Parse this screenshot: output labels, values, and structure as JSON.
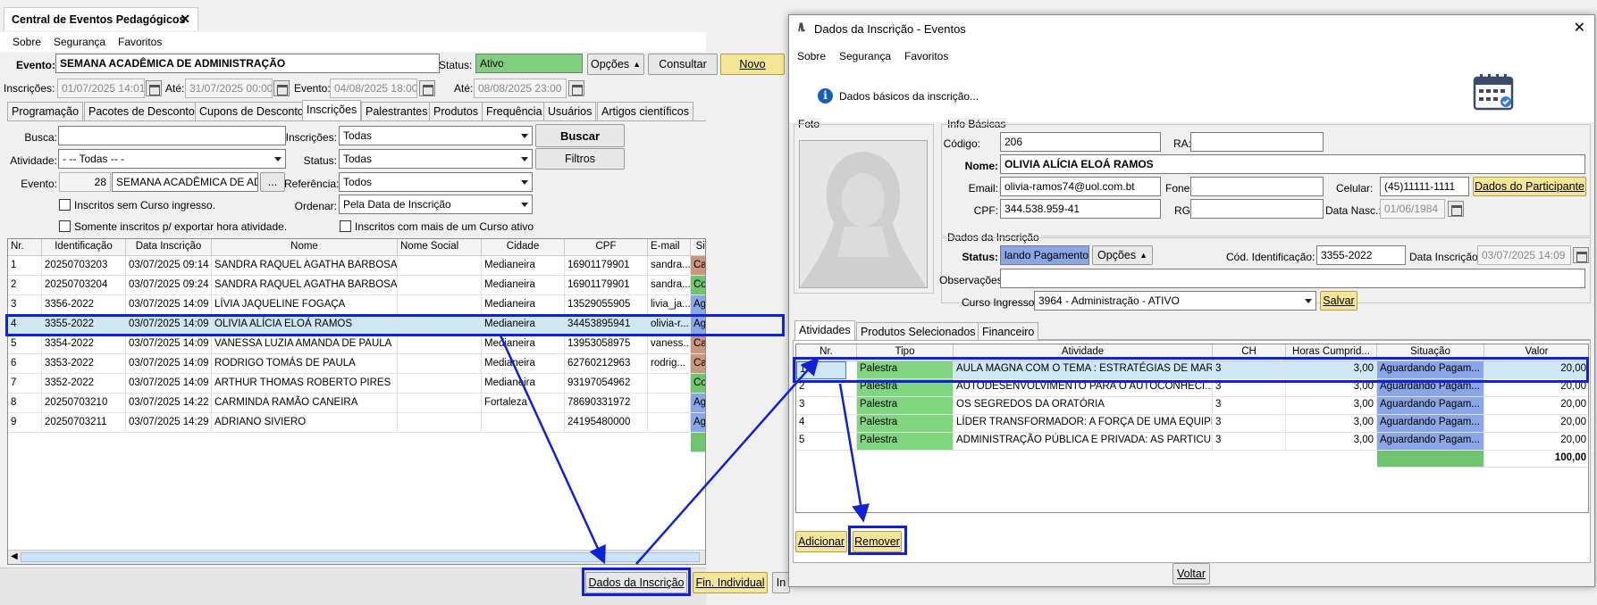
{
  "main": {
    "tab_title": "Central de Eventos Pedagógicos",
    "menu": [
      "Sobre",
      "Segurança",
      "Favoritos"
    ],
    "evento_label": "Evento:",
    "evento_value": "SEMANA ACADÊMICA DE ADMINISTRAÇÃO",
    "status_label": "Status:",
    "status_value": "Ativo",
    "opcoes_btn": "Opções",
    "consultar_btn": "Consultar",
    "novo_btn": "Novo",
    "inscricoes_label": "Inscrições:",
    "inscricoes_from": "01/07/2025 14:01",
    "ate_label": "Até:",
    "inscricoes_to": "31/07/2025 00:00",
    "evento_date_label": "Evento:",
    "evento_from": "04/08/2025 18:00",
    "evento_ate_label": "Até:",
    "evento_to": "08/08/2025 23:00",
    "tabs": [
      "Programação",
      "Pacotes de Desconto",
      "Cupons de Desconto",
      "Inscrições",
      "Palestrantes",
      "Produtos",
      "Frequência",
      "Usuários",
      "Artigos científicos"
    ],
    "filters": {
      "busca_label": "Busca:",
      "busca_value": "",
      "inscricoes_label": "Inscrições:",
      "inscricoes_value": "Todas",
      "buscar_btn": "Buscar",
      "atividade_label": "Atividade:",
      "atividade_value": "- -- Todas -- -",
      "status_label": "Status:",
      "status_value": "Todas",
      "filtros_btn": "Filtros",
      "evento_label": "Evento:",
      "evento_num": "28",
      "evento_name": "SEMANA ACADÊMICA DE ADM",
      "evento_more": "...",
      "referencia_label": "Referência:",
      "referencia_value": "Todos",
      "ordenar_label": "Ordenar:",
      "ordenar_value": "Pela Data de Inscrição",
      "chk1": "Inscritos sem Curso ingresso.",
      "chk2": "Somente inscritos p/ exportar hora atividade.",
      "chk3": "Inscritos com mais de um Curso ativo"
    },
    "columns": [
      "Nr.",
      "Identificação",
      "Data Inscrição",
      "Nome",
      "Nome Social",
      "Cidade",
      "CPF",
      "E-mail",
      "Situação no Evento"
    ],
    "rows": [
      [
        "1",
        "20250703203",
        "03/07/2025 09:14",
        "SANDRA RAQUEL AGATHA BARBOSA",
        "",
        "Medianeira",
        "16901179901",
        "sandra...",
        "Cancelada"
      ],
      [
        "2",
        "20250703204",
        "03/07/2025 09:24",
        "SANDRA RAQUEL AGATHA BARBOSA",
        "",
        "Medianeira",
        "16901179901",
        "sandra...",
        "Confirmada"
      ],
      [
        "3",
        "3356-2022",
        "03/07/2025 14:09",
        "LÍVIA JAQUELINE FOGAÇA",
        "",
        "Medianeira",
        "13529055905",
        "livia_ja...",
        "Aguardando Paga..."
      ],
      [
        "4",
        "3355-2022",
        "03/07/2025 14:09",
        "OLIVIA ALÍCIA ELOÁ RAMOS",
        "",
        "Medianeira",
        "34453895941",
        "olivia-r...",
        "Aguardando Paga..."
      ],
      [
        "5",
        "3354-2022",
        "03/07/2025 14:09",
        "VANESSA LUZIA AMANDA DE PAULA",
        "",
        "Medianeira",
        "13953058975",
        "vaness...",
        "Cancelada"
      ],
      [
        "6",
        "3353-2022",
        "03/07/2025 14:09",
        "RODRIGO TOMÁS DE PAULA",
        "",
        "Medianeira",
        "62760212963",
        "rodrig...",
        "Cancelada"
      ],
      [
        "7",
        "3352-2022",
        "03/07/2025 14:09",
        "ARTHUR THOMAS ROBERTO PIRES",
        "",
        "Medianeira",
        "93197054962",
        "",
        "Confirmada"
      ],
      [
        "8",
        "20250703210",
        "03/07/2025 14:22",
        "CARMINDA RAMÃO CANEIRA",
        "",
        "Fortaleza",
        "78690331972",
        "",
        "Aguardando Paga..."
      ],
      [
        "9",
        "20250703211",
        "03/07/2025 14:29",
        "ADRIANO SIVIERO",
        "",
        "",
        "24195480000",
        "",
        "Aguardando Paga..."
      ]
    ],
    "bottom": {
      "dados_btn": "Dados da Inscrição",
      "fin_btn": "Fin. Individual",
      "extra_btn": "In"
    }
  },
  "dialog": {
    "title": "Dados da Inscrição - Eventos",
    "menu": [
      "Sobre",
      "Segurança",
      "Favoritos"
    ],
    "header_text": "Dados básicos da inscrição...",
    "foto_label": "Foto",
    "info_label": "Info Básicas",
    "codigo_label": "Código:",
    "codigo_value": "206",
    "ra_label": "RA:",
    "ra_value": "",
    "nome_label": "Nome:",
    "nome_value": "OLIVIA ALÍCIA ELOÁ RAMOS",
    "email_label": "Email:",
    "email_value": "olivia-ramos74@uol.com.bt",
    "fone_label": "Fone:",
    "fone_value": "",
    "celular_label": "Celular:",
    "celular_value": "(45)11111-1111",
    "dados_part_btn": "Dados do Participante",
    "cpf_label": "CPF:",
    "cpf_value": "344.538.959-41",
    "rg_label": "RG:",
    "rg_value": "",
    "nasc_label": "Data Nasc.:",
    "nasc_value": "01/06/1984",
    "dados_insc_label": "Dados da Inscrição",
    "status_label": "Status:",
    "status_value": "lando Pagamento",
    "opcoes_btn": "Opções",
    "cod_ident_label": "Cód. Identificação:",
    "cod_ident_value": "3355-2022",
    "data_insc_label": "Data Inscrição:",
    "data_insc_value": "03/07/2025 14:09",
    "obs_label": "Observações:",
    "obs_value": "",
    "curso_label": "Curso Ingresso:",
    "curso_value": "3964 - Administração - ATIVO",
    "salvar_btn": "Salvar",
    "tabs": [
      "Atividades",
      "Produtos Selecionados",
      "Financeiro"
    ],
    "columns": [
      "Nr.",
      "Tipo",
      "Atividade",
      "CH",
      "Horas Cumprid...",
      "Situação",
      "Valor"
    ],
    "rows": [
      [
        "1",
        "Palestra",
        "AULA MAGNA COM O TEMA : ESTRATÉGIAS DE MAR...",
        "3",
        "3,00",
        "Aguardando Pagam...",
        "20,00"
      ],
      [
        "2",
        "Palestra",
        "AUTODESENVOLVIMENTO PARA O AUTOCONHECI...",
        "3",
        "3,00",
        "Aguardando Pagam...",
        "20,00"
      ],
      [
        "3",
        "Palestra",
        "OS SEGREDOS DA ORATÓRIA",
        "3",
        "3,00",
        "Aguardando Pagam...",
        "20,00"
      ],
      [
        "4",
        "Palestra",
        "LÍDER TRANSFORMADOR: A FORÇA DE UMA EQUIPE...",
        "3",
        "3,00",
        "Aguardando Pagam...",
        "20,00"
      ],
      [
        "5",
        "Palestra",
        "ADMINISTRAÇÃO PÚBLICA E PRIVADA: AS PARTICUL...",
        "3",
        "3,00",
        "Aguardando Pagam...",
        "20,00"
      ]
    ],
    "total": "100,00",
    "adicionar_btn": "Adicionar",
    "remover_btn": "Remover",
    "voltar_btn": "Voltar"
  },
  "colors": {
    "cancelada": "#c9967f",
    "confirmada": "#6fc46f",
    "aguardando": "#8aa6e6",
    "palestra": "#7fd67f",
    "ativo": "#7fcf7f",
    "highlight": "#0f22d6"
  }
}
